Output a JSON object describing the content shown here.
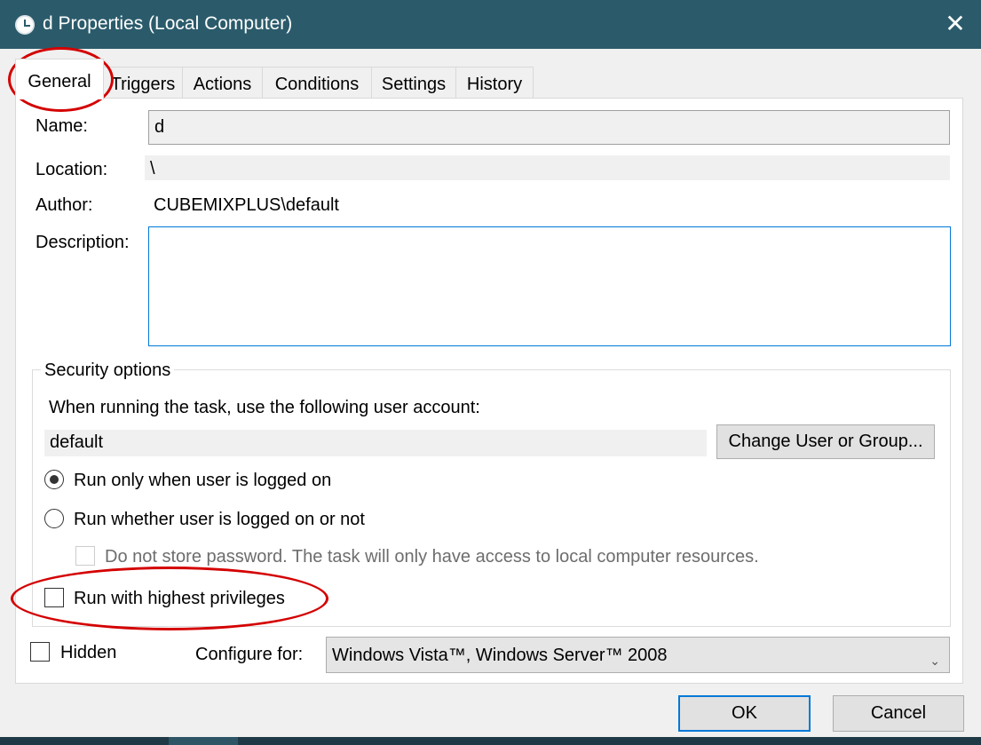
{
  "window": {
    "title": "d Properties (Local Computer)",
    "close_glyph": "✕"
  },
  "tabs": [
    {
      "label": "General",
      "active": true
    },
    {
      "label": "Triggers",
      "active": false
    },
    {
      "label": "Actions",
      "active": false
    },
    {
      "label": "Conditions",
      "active": false
    },
    {
      "label": "Settings",
      "active": false
    },
    {
      "label": "History",
      "active": false
    }
  ],
  "general": {
    "name_label": "Name:",
    "name_value": "d",
    "location_label": "Location:",
    "location_value": "\\",
    "author_label": "Author:",
    "author_value": "CUBEMIXPLUS\\default",
    "description_label": "Description:",
    "description_value": ""
  },
  "security": {
    "legend": "Security options",
    "account_prompt": "When running the task, use the following user account:",
    "account_value": "default",
    "change_button": "Change User or Group...",
    "radio_logged_on": "Run only when user is logged on",
    "radio_logged_on_checked": true,
    "radio_whether": "Run whether user is logged on or not",
    "radio_whether_checked": false,
    "no_store_password": "Do not store password.  The task will only have access to local computer resources.",
    "no_store_password_checked": false,
    "highest_privileges": "Run with highest privileges",
    "highest_privileges_checked": false
  },
  "bottom": {
    "hidden_label": "Hidden",
    "hidden_checked": false,
    "configure_label": "Configure for:",
    "configure_value": "Windows Vista™, Windows Server™ 2008"
  },
  "buttons": {
    "ok": "OK",
    "cancel": "Cancel"
  },
  "colors": {
    "titlebar": "#2b5b6b",
    "annotation": "#d40000",
    "focus_accent": "#0078d7"
  }
}
